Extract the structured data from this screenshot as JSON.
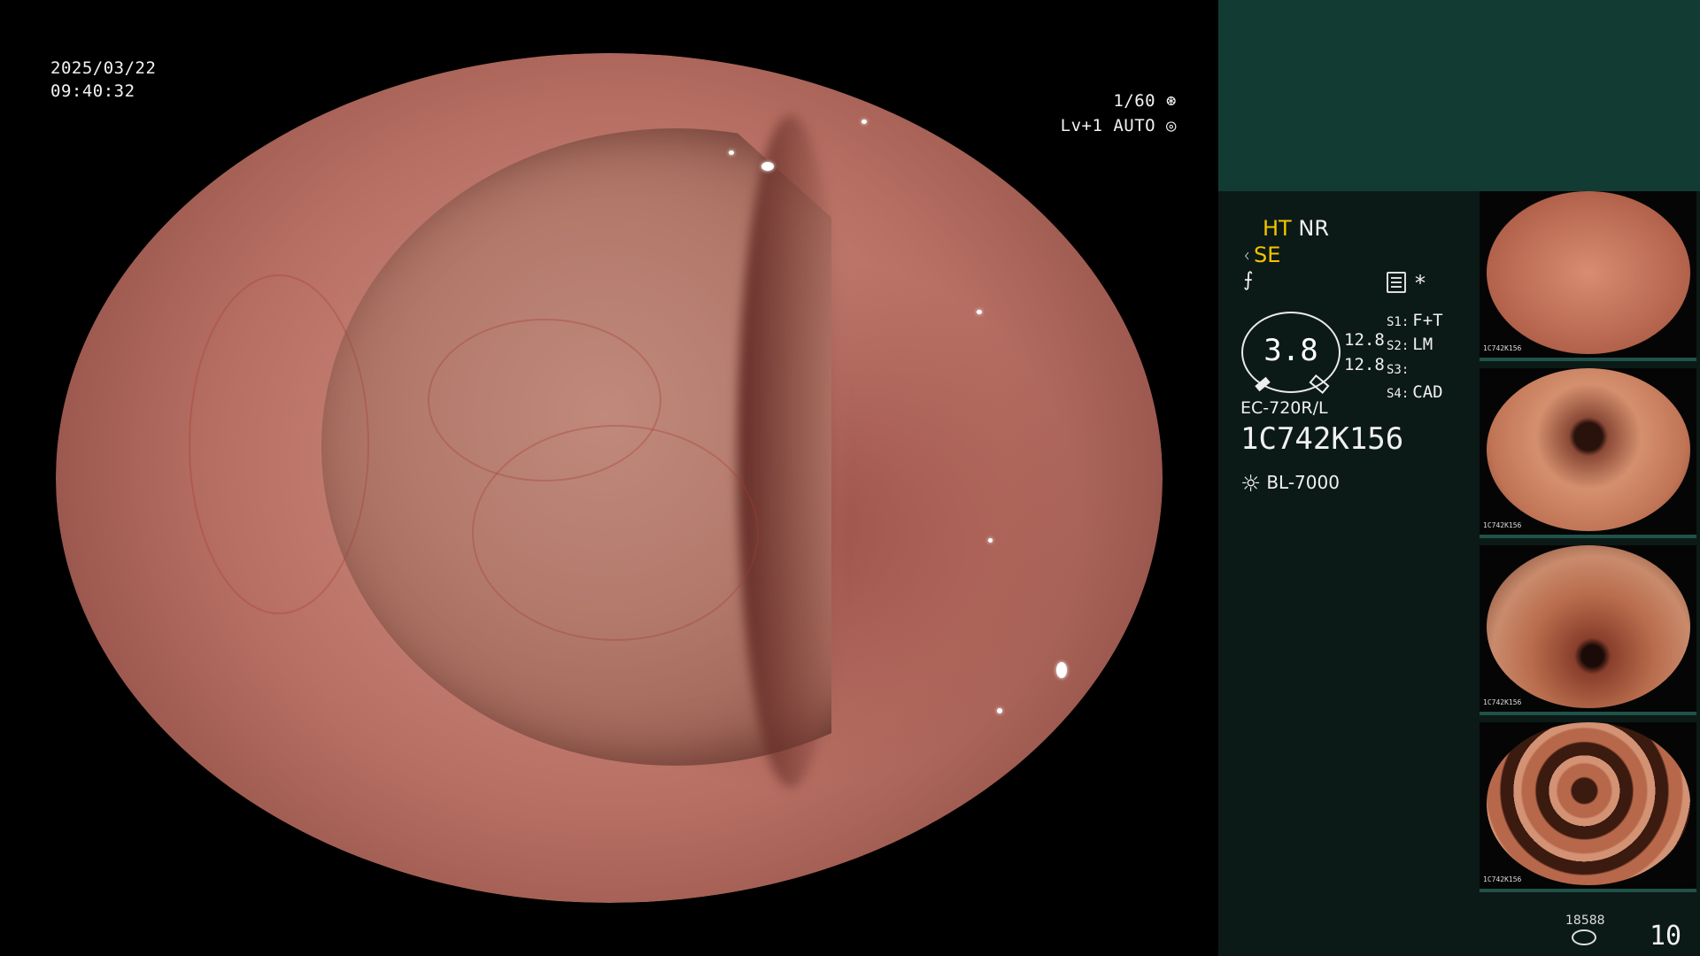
{
  "overlay": {
    "date": "2025/03/22",
    "time": "09:40:32",
    "shutter": "1/60",
    "level_mode": "Lv+1 AUTO"
  },
  "panel": {
    "ht": "HT",
    "nr": "NR",
    "se": "SE",
    "f_symbol": "⨍",
    "star": "*",
    "gauge_value": "3.8",
    "num_top": "12.8",
    "num_bottom": "12.8",
    "s1_key": "S1:",
    "s1_val": "F+T",
    "s2_key": "S2:",
    "s2_val": "LM",
    "s3_key": "S3:",
    "s3_val": "",
    "s4_key": "S4:",
    "s4_val": "CAD",
    "model": "EC-720R/L",
    "serial": "1C742K156",
    "light_source": "BL-7000",
    "count_small": "18588",
    "count_big": "10"
  },
  "thumbnails": [
    {
      "label": "1C742K156"
    },
    {
      "label": "1C742K156"
    },
    {
      "label": "1C742K156"
    },
    {
      "label": "1C742K156"
    }
  ],
  "colors": {
    "panel_bg": "#0c1a17",
    "panel_top_bg": "#123b34",
    "accent_yellow": "#f5c300"
  }
}
